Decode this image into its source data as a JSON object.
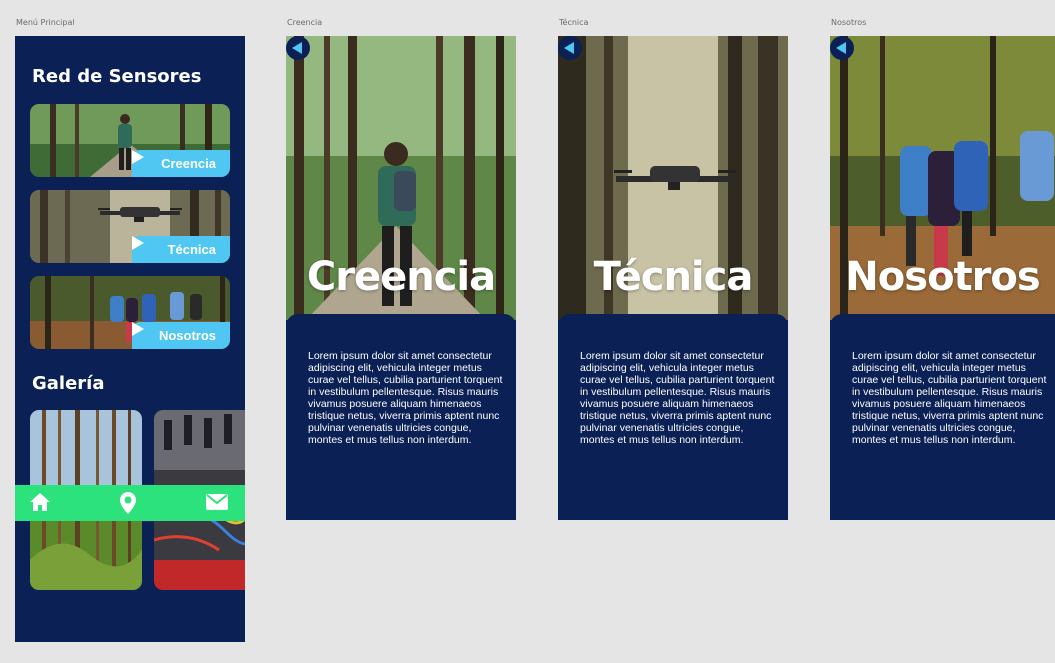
{
  "artboards": {
    "menu": "Menú Principal",
    "creencia": "Creencia",
    "tecnica": "Técnica",
    "nosotros": "Nosotros"
  },
  "menu": {
    "title": "Red de Sensores",
    "cards": [
      {
        "label": "Creencia"
      },
      {
        "label": "Técnica"
      },
      {
        "label": "Nosotros"
      }
    ],
    "gallery_title": "Galería",
    "nav_icons": [
      "home-icon",
      "location-pin-icon",
      "mail-icon"
    ]
  },
  "pages": {
    "creencia": {
      "title": "Creencia",
      "body": "Lorem ipsum dolor sit amet consectetur adipiscing elit, vehicula integer metus curae vel tellus, cubilia parturient torquent in vestibulum pellentesque. Risus mauris vivamus posuere aliquam himenaeos tristique netus, viverra primis aptent nunc pulvinar venenatis ultricies congue, montes et mus tellus non interdum."
    },
    "tecnica": {
      "title": "Técnica",
      "body": "Lorem ipsum dolor sit amet consectetur adipiscing elit, vehicula integer metus curae vel tellus, cubilia parturient torquent in vestibulum pellentesque. Risus mauris vivamus posuere aliquam himenaeos tristique netus, viverra primis aptent nunc pulvinar venenatis ultricies congue, montes et mus tellus non interdum."
    },
    "nosotros": {
      "title": "Nosotros",
      "body": "Lorem ipsum dolor sit amet consectetur adipiscing elit, vehicula integer metus curae vel tellus, cubilia parturient torquent in vestibulum pellentesque. Risus mauris vivamus posuere aliquam himenaeos tristique netus, viverra primis aptent nunc pulvinar venenatis ultricies congue, montes et mus tellus non interdum."
    }
  },
  "colors": {
    "navy": "#0b2155",
    "accent_blue": "#4fc7f2",
    "nav_green": "#2ce27d",
    "canvas": "#e5e5e5"
  }
}
